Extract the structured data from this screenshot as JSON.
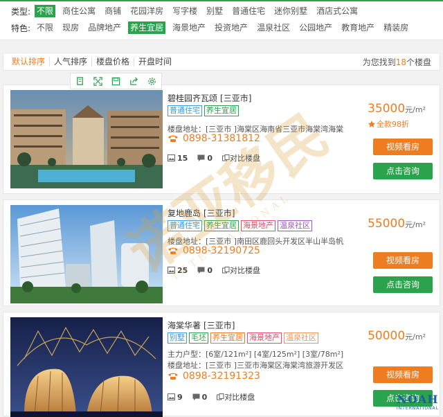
{
  "filters": {
    "type_label": "类型:",
    "types": [
      "不限",
      "商住公寓",
      "商铺",
      "花园洋房",
      "写字楼",
      "别墅",
      "普通住宅",
      "迷你别墅",
      "酒店式公寓"
    ],
    "feature_label": "特色:",
    "features": [
      "不限",
      "现房",
      "品牌地产",
      "养生宜居",
      "海景地产",
      "投资地产",
      "温泉社区",
      "公园地产",
      "教育地产",
      "精装房"
    ]
  },
  "sortbar": {
    "items": [
      "默认排序",
      "人气排序",
      "楼盘价格",
      "开盘时间"
    ],
    "result_prefix": "为您找到",
    "result_count": "18",
    "result_suffix": "个楼盘"
  },
  "toolbar_icons": [
    "copy-icon",
    "expand-icon",
    "save-icon",
    "share-icon",
    "settings-icon"
  ],
  "watermark": {
    "text": "诺亚移民",
    "subtext": "INTERNATIONAL"
  },
  "brand_mark": {
    "big": "NOAH",
    "small": "INTERNATIONAL"
  },
  "listings": [
    {
      "title": "碧桂园齐瓦颂",
      "city": "[三亚市]",
      "tags": [
        {
          "text": "普通住宅",
          "color": "blue"
        },
        {
          "text": "养生宜居",
          "color": "green"
        }
      ],
      "details": [
        "楼盘地址：[三亚市 ]海棠区海南省三亚市海棠湾海棠大道..."
      ],
      "phone": "0898-31381812",
      "photo_count": "15",
      "comment_count": "0",
      "compare_label": "对比楼盘",
      "price": "35000",
      "price_unit": "元/m²",
      "discount": "全款98折",
      "video_button": "视频看房",
      "consult_button": "点击咨询"
    },
    {
      "title": "复地鹿岛",
      "city": "[三亚市]",
      "tags": [
        {
          "text": "普通住宅",
          "color": "blue"
        },
        {
          "text": "养生宜居",
          "color": "green"
        },
        {
          "text": "海景地产",
          "color": "pink"
        },
        {
          "text": "温泉社区",
          "color": "purple"
        }
      ],
      "details": [
        "楼盘地址：[三亚市 ]南田区鹿回头开发区半山半岛帆船港..."
      ],
      "phone": "0898-32190725",
      "photo_count": "25",
      "comment_count": "0",
      "compare_label": "对比楼盘",
      "price": "55000",
      "price_unit": "元/m²",
      "discount": "",
      "video_button": "视频看房",
      "consult_button": "点击咨询"
    },
    {
      "title": "海棠华著",
      "city": "[三亚市]",
      "tags": [
        {
          "text": "别墅",
          "color": "blue"
        },
        {
          "text": "毛坯",
          "color": "green"
        },
        {
          "text": "养生宜居",
          "color": "orange"
        },
        {
          "text": "海景地产",
          "color": "pink"
        },
        {
          "text": "温泉社区",
          "color": "peach"
        }
      ],
      "details": [
        "主力户型：[6室/121m²] [4室/125m²] [3室/78m²]",
        "楼盘地址：[三亚市 ]三亚市海棠区海棠湾旅游开发区海棠..."
      ],
      "phone": "0898-32191323",
      "photo_count": "9",
      "comment_count": "0",
      "compare_label": "对比楼盘",
      "price": "50000",
      "price_unit": "元/m²",
      "discount": "",
      "video_button": "视频看房",
      "consult_button": "点击咨询"
    }
  ],
  "colors": {
    "accent": "#2ba24c",
    "price": "#ee7d22"
  }
}
